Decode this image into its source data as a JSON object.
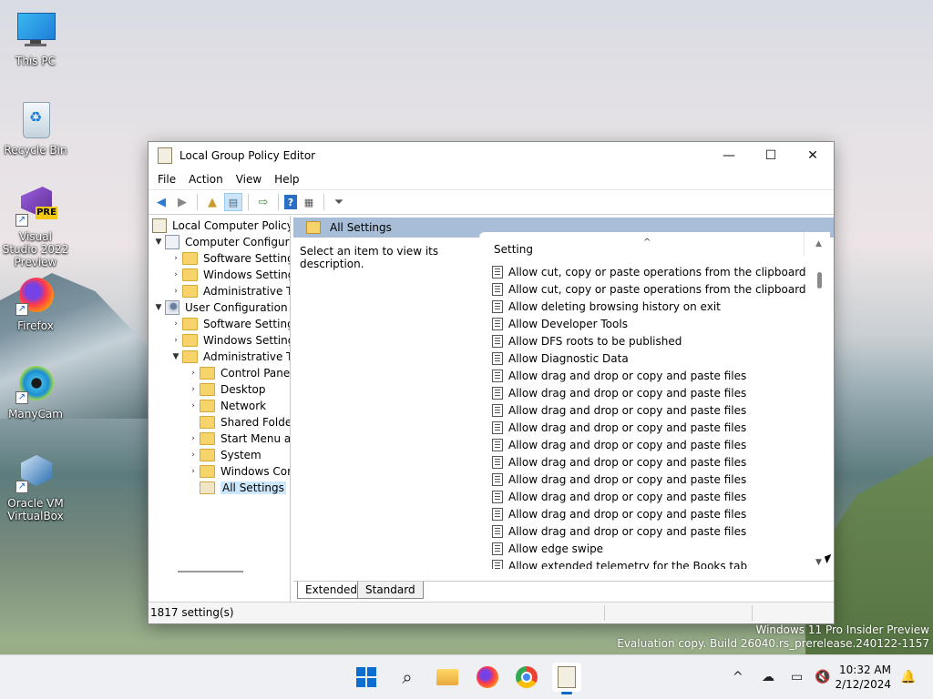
{
  "desktop": {
    "icons": [
      {
        "label": "This PC",
        "icon": "monitor-icon"
      },
      {
        "label": "Recycle Bin",
        "icon": "recycle-bin-icon"
      },
      {
        "label": "Visual Studio 2022 Preview",
        "icon": "visual-studio-icon",
        "badge": "PRE"
      },
      {
        "label": "Firefox",
        "icon": "firefox-icon"
      },
      {
        "label": "ManyCam",
        "icon": "manycam-icon"
      },
      {
        "label": "Oracle VM VirtualBox",
        "icon": "virtualbox-icon"
      }
    ],
    "watermark_line1": "Windows 11 Pro Insider Preview",
    "watermark_line2": "Evaluation copy. Build 26040.rs_prerelease.240122-1157"
  },
  "window": {
    "title": "Local Group Policy Editor",
    "controls": {
      "minimize": "—",
      "maximize": "☐",
      "close": "✕"
    },
    "menu": [
      "File",
      "Action",
      "View",
      "Help"
    ],
    "tree": {
      "root": "Local Computer Policy",
      "computer_config": "Computer Configura",
      "cc_software": "Software Settings",
      "cc_windows": "Windows Setting",
      "cc_admin": "Administrative Te",
      "user_config": "User Configuration",
      "uc_software": "Software Settings",
      "uc_windows": "Windows Setting",
      "uc_admin": "Administrative Te",
      "control_panel": "Control Panel",
      "desktop": "Desktop",
      "network": "Network",
      "shared_folders": "Shared Folder",
      "start_menu": "Start Menu ar",
      "system": "System",
      "windows_components": "Windows Cor",
      "all_settings": "All Settings"
    },
    "right_header": "All Settings",
    "description": "Select an item to view its description.",
    "column_header": "Setting",
    "settings": [
      "Allow cut, copy or paste operations from the clipboard via s...",
      "Allow cut, copy or paste operations from the clipboard via s...",
      "Allow deleting browsing history on exit",
      "Allow Developer Tools",
      "Allow DFS roots to be published",
      "Allow Diagnostic Data",
      "Allow drag and drop or copy and paste files",
      "Allow drag and drop or copy and paste files",
      "Allow drag and drop or copy and paste files",
      "Allow drag and drop or copy and paste files",
      "Allow drag and drop or copy and paste files",
      "Allow drag and drop or copy and paste files",
      "Allow drag and drop or copy and paste files",
      "Allow drag and drop or copy and paste files",
      "Allow drag and drop or copy and paste files",
      "Allow drag and drop or copy and paste files",
      "Allow edge swipe",
      "Allow extended telemetry for the Books tab"
    ],
    "tabs": [
      "Extended",
      "Standard"
    ],
    "status": "1817 setting(s)"
  },
  "taskbar": {
    "clock_time": "10:32 AM",
    "clock_date": "2/12/2024"
  },
  "colors": {
    "accent": "#0067c0",
    "pane_header": "#a8bed8",
    "selection": "#cce8ff"
  }
}
